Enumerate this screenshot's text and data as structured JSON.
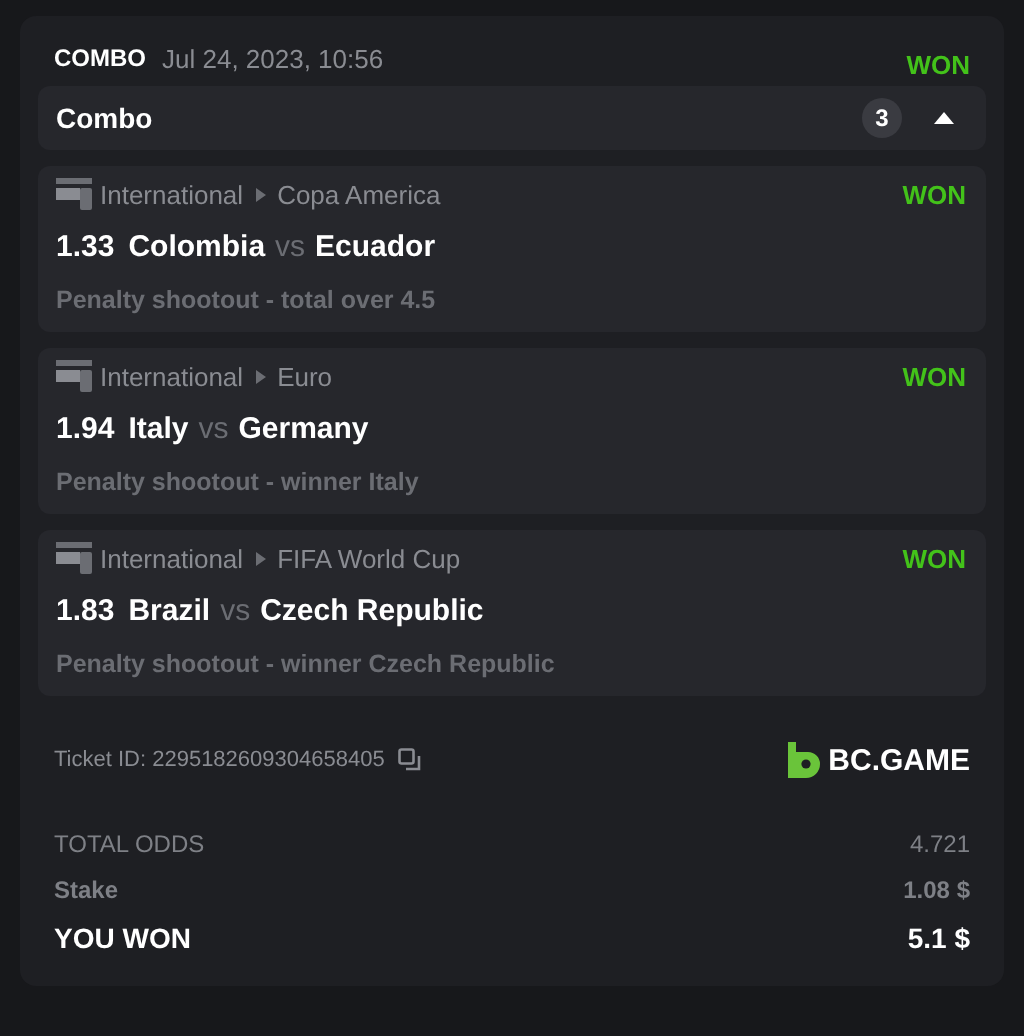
{
  "header": {
    "type": "COMBO",
    "date": "Jul 24, 2023, 10:56",
    "status": "WON"
  },
  "combo": {
    "title": "Combo",
    "count": "3",
    "expanded": true
  },
  "legs": [
    {
      "category": "International",
      "league": "Copa America",
      "status": "WON",
      "odds": "1.33",
      "home": "Colombia",
      "vs": "vs",
      "away": "Ecuador",
      "market": "Penalty shootout - total over 4.5"
    },
    {
      "category": "International",
      "league": "Euro",
      "status": "WON",
      "odds": "1.94",
      "home": "Italy",
      "vs": "vs",
      "away": "Germany",
      "market": "Penalty shootout - winner Italy"
    },
    {
      "category": "International",
      "league": "FIFA World Cup",
      "status": "WON",
      "odds": "1.83",
      "home": "Brazil",
      "vs": "vs",
      "away": "Czech Republic",
      "market": "Penalty shootout - winner Czech Republic"
    }
  ],
  "ticket": {
    "label": "Ticket ID: 2295182609304658405",
    "brand": "BC.GAME"
  },
  "summary": {
    "total_odds_label": "TOTAL ODDS",
    "total_odds": "4.721",
    "stake_label": "Stake",
    "stake": "1.08 $",
    "won_label": "YOU WON",
    "won": "5.1 $"
  }
}
